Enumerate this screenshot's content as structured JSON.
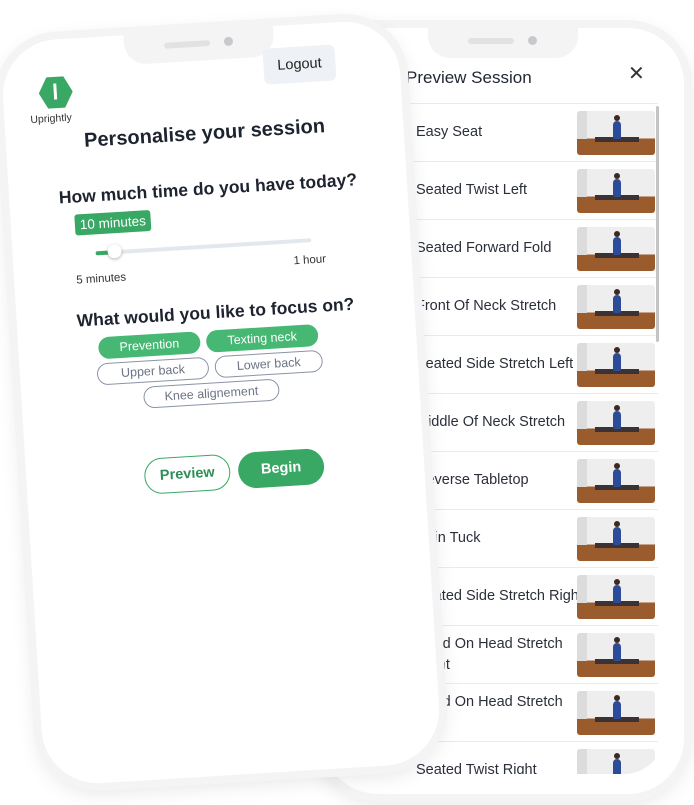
{
  "colors": {
    "accent": "#3aa865",
    "chip_on": "#46b873"
  },
  "preview": {
    "title": "Preview Session",
    "close_icon": "✕",
    "items": [
      "Easy Seat",
      "Seated Twist Left",
      "Seated Forward Fold",
      "Front Of Neck Stretch",
      "Seated Side Stretch Left",
      "Middle Of Neck Stretch",
      "Reverse Tabletop",
      "Chin Tuck",
      "Seated Side Stretch Right",
      "Hand On Head Stretch Right",
      "Hand On Head Stretch Left",
      "Seated Twist Right"
    ]
  },
  "personalise": {
    "logout": "Logout",
    "brand": "Uprightly",
    "title": "Personalise your session",
    "time_question": "How much time do you have today?",
    "time_value": "10 minutes",
    "slider_fraction": 0.09,
    "slider_min": "5 minutes",
    "slider_max": "1 hour",
    "focus_question": "What would you like to focus on?",
    "chips": [
      {
        "label": "Prevention",
        "selected": true
      },
      {
        "label": "Texting neck",
        "selected": true
      },
      {
        "label": "Upper back",
        "selected": false
      },
      {
        "label": "Lower back",
        "selected": false
      },
      {
        "label": "Knee alignement",
        "selected": false
      }
    ],
    "preview_button": "Preview",
    "begin_button": "Begin"
  }
}
